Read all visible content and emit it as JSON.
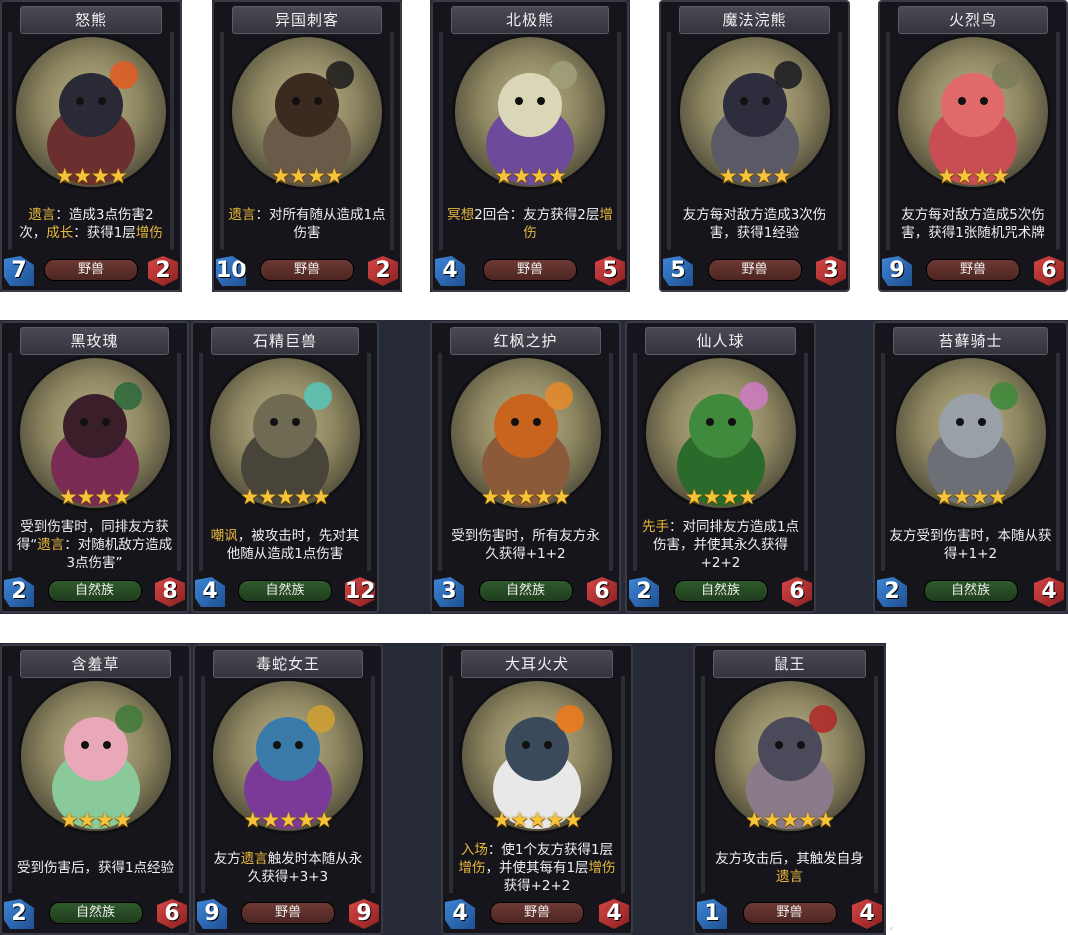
{
  "cards": [
    {
      "name": "怒熊",
      "stars": "★★★★",
      "atk": "7",
      "hp": "2",
      "tribe": "野兽",
      "art": "bear-icon",
      "desc": [
        {
          "t": "遗言",
          "k": true
        },
        {
          "t": "：造成3点伤害2次，"
        },
        {
          "t": "成长",
          "k": true
        },
        {
          "t": "：获得1层"
        },
        {
          "t": "增伤",
          "k": true
        }
      ]
    },
    {
      "name": "异国刺客",
      "stars": "★★★★",
      "atk": "10",
      "hp": "2",
      "tribe": "野兽",
      "art": "hedgehog-icon",
      "desc": [
        {
          "t": "遗言",
          "k": true
        },
        {
          "t": "：对所有随从造成1点伤害"
        }
      ]
    },
    {
      "name": "北极熊",
      "stars": "★★★★",
      "atk": "4",
      "hp": "5",
      "tribe": "野兽",
      "art": "polar-bear-icon",
      "desc": [
        {
          "t": "冥想",
          "k": true
        },
        {
          "t": "2回合：友方获得2层"
        },
        {
          "t": "增伤",
          "k": true
        }
      ]
    },
    {
      "name": "魔法浣熊",
      "stars": "★★★★",
      "atk": "5",
      "hp": "3",
      "tribe": "野兽",
      "art": "raccoon-icon",
      "desc": [
        {
          "t": "友方每对敌方造成3次伤害，获得1经验"
        }
      ]
    },
    {
      "name": "火烈鸟",
      "stars": "★★★★",
      "atk": "9",
      "hp": "6",
      "tribe": "野兽",
      "art": "flamingo-icon",
      "desc": [
        {
          "t": "友方每对敌方造成5次伤害，获得1张随机咒术牌"
        }
      ]
    },
    {
      "name": "黑玫瑰",
      "stars": "★★★★",
      "atk": "2",
      "hp": "8",
      "tribe": "自然族",
      "art": "rose-icon",
      "desc": [
        {
          "t": "受到伤害时，同排友方获得“"
        },
        {
          "t": "遗言",
          "k": true
        },
        {
          "t": "：对随机敌方造成3点伤害”"
        }
      ]
    },
    {
      "name": "石精巨兽",
      "stars": "★★★★★",
      "atk": "4",
      "hp": "12",
      "tribe": "自然族",
      "art": "golem-icon",
      "desc": [
        {
          "t": "嘲讽",
          "k": true
        },
        {
          "t": "，被攻击时，先对其他随从造成1点伤害"
        }
      ]
    },
    {
      "name": "红枫之护",
      "stars": "★★★★★",
      "atk": "3",
      "hp": "6",
      "tribe": "自然族",
      "art": "maple-tree-icon",
      "desc": [
        {
          "t": "受到伤害时，所有友方永久获得+1+2"
        }
      ]
    },
    {
      "name": "仙人球",
      "stars": "★★★★",
      "atk": "2",
      "hp": "6",
      "tribe": "自然族",
      "art": "cactus-icon",
      "desc": [
        {
          "t": "先手",
          "k": true
        },
        {
          "t": "：对同排友方造成1点伤害，并使其永久获得+2+2"
        }
      ]
    },
    {
      "name": "苔藓骑士",
      "stars": "★★★★",
      "atk": "2",
      "hp": "4",
      "tribe": "自然族",
      "art": "moss-knight-icon",
      "desc": [
        {
          "t": "友方受到伤害时，本随从获得+1+2"
        }
      ]
    },
    {
      "name": "含羞草",
      "stars": "★★★★",
      "atk": "2",
      "hp": "6",
      "tribe": "自然族",
      "art": "mimosa-icon",
      "desc": [
        {
          "t": "受到伤害后，获得1点经验"
        }
      ]
    },
    {
      "name": "毒蛇女王",
      "stars": "★★★★★",
      "atk": "9",
      "hp": "9",
      "tribe": "野兽",
      "art": "snake-queen-icon",
      "desc": [
        {
          "t": "友方"
        },
        {
          "t": "遗言",
          "k": true
        },
        {
          "t": "触发时本随从永久获得+3+3"
        }
      ]
    },
    {
      "name": "大耳火犬",
      "stars": "★★★★★",
      "atk": "4",
      "hp": "4",
      "tribe": "野兽",
      "art": "fire-dog-icon",
      "desc": [
        {
          "t": "入场",
          "k": true
        },
        {
          "t": "：使1个友方获得1层"
        },
        {
          "t": "增伤",
          "k": true
        },
        {
          "t": "，并使其每有1层"
        },
        {
          "t": "增伤",
          "k": true
        },
        {
          "t": "获得+2+2"
        }
      ]
    },
    {
      "name": "鼠王",
      "stars": "★★★★★",
      "atk": "1",
      "hp": "4",
      "tribe": "野兽",
      "art": "rat-king-icon",
      "desc": [
        {
          "t": "友方攻击后，其触发自身"
        },
        {
          "t": "遗言",
          "k": true
        }
      ]
    }
  ]
}
